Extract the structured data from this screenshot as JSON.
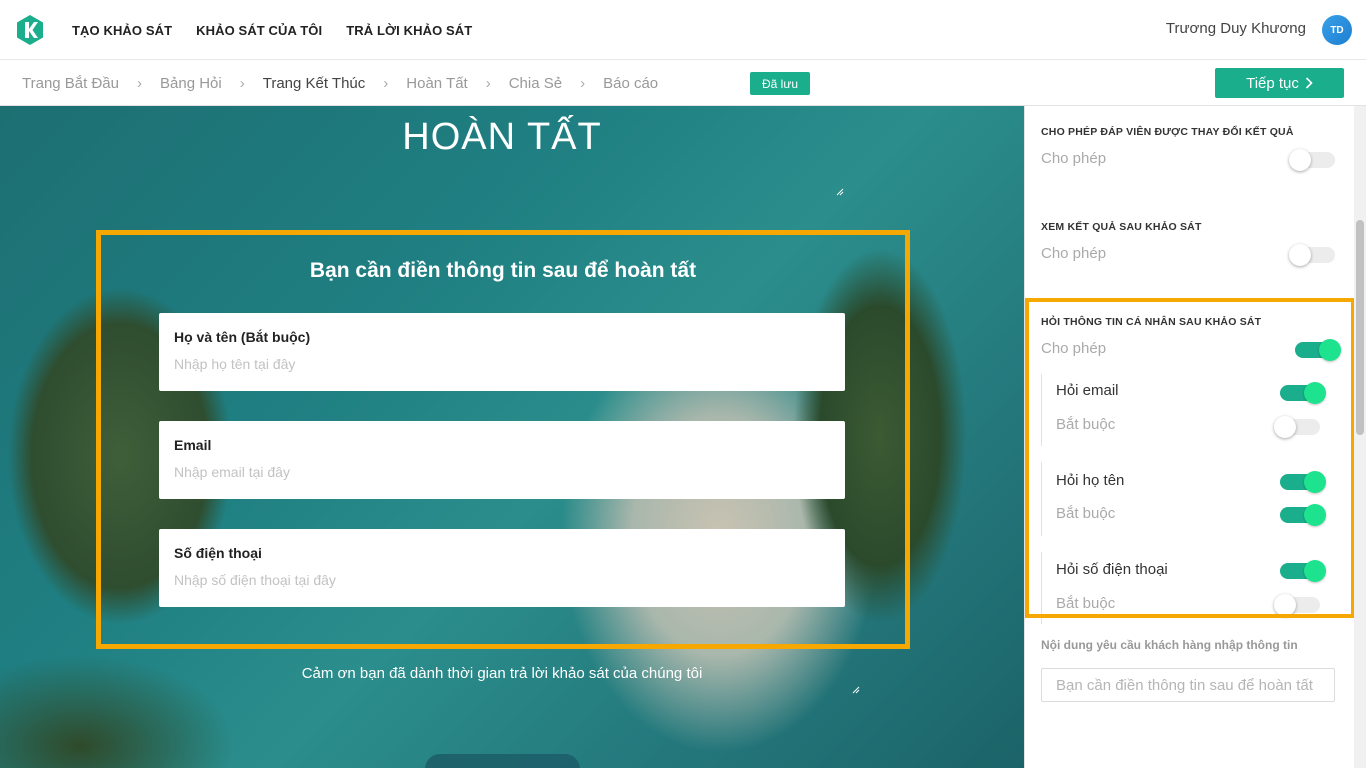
{
  "header": {
    "logo_icon": "k-logo-icon",
    "menu": [
      {
        "label": "TẠO KHẢO SÁT"
      },
      {
        "label": "KHẢO SÁT CỦA TÔI"
      },
      {
        "label": "TRẢ LỜI KHẢO SÁT"
      }
    ],
    "user_name": "Trương Duy Khương",
    "avatar_initials": "TD"
  },
  "steps": {
    "items": [
      {
        "label": "Trang Bắt Đầu",
        "active": false
      },
      {
        "label": "Bảng Hỏi",
        "active": false
      },
      {
        "label": "Trang Kết Thúc",
        "active": true
      },
      {
        "label": "Hoàn Tất",
        "active": false
      },
      {
        "label": "Chia Sẻ",
        "active": false
      },
      {
        "label": "Báo cáo",
        "active": false
      }
    ],
    "separator": "›",
    "saved_badge": "Đã lưu",
    "continue_label": "Tiếp tục",
    "continue_icon": "chevron-right-icon"
  },
  "preview": {
    "title": "HOÀN TẤT",
    "form_heading": "Bạn cần điền thông tin sau để hoàn tất",
    "fields": [
      {
        "label": "Họ và tên (Bắt buộc)",
        "placeholder": "Nhập họ tên tại đây",
        "value": ""
      },
      {
        "label": "Email",
        "placeholder": "Nhập email tại đây",
        "value": ""
      },
      {
        "label": "Số điện thoại",
        "placeholder": "Nhập số điện thoại tại đây",
        "value": ""
      }
    ],
    "thanks": "Cảm ơn bạn đã dành thời gian trả lời khảo sát của chúng tôi"
  },
  "panel": {
    "allow_change": {
      "title": "CHO PHÉP ĐÁP VIÊN ĐƯỢC THAY ĐỔI KẾT QUẢ",
      "sub": "Cho phép",
      "enabled": false
    },
    "view_results": {
      "title": "XEM KẾT QUẢ SAU KHẢO SÁT",
      "sub": "Cho phép",
      "enabled": false
    },
    "ask_info": {
      "title": "HỎI THÔNG TIN CÁ NHÂN SAU KHẢO SÁT",
      "sub": "Cho phép",
      "enabled": true,
      "items": [
        {
          "label": "Hỏi email",
          "enabled": true,
          "required_label": "Bắt buộc",
          "required": false
        },
        {
          "label": "Hỏi họ tên",
          "enabled": true,
          "required_label": "Bắt buộc",
          "required": true
        },
        {
          "label": "Hỏi số điện thoại",
          "enabled": true,
          "required_label": "Bắt buộc",
          "required": false
        }
      ]
    },
    "request_label": "Nội dung yêu cầu khách hàng nhập thông tin",
    "request_placeholder": "Bạn cần điền thông tin sau để hoàn tất",
    "request_value": ""
  },
  "colors": {
    "accent": "#1aae8c",
    "highlight": "#f7a800"
  }
}
